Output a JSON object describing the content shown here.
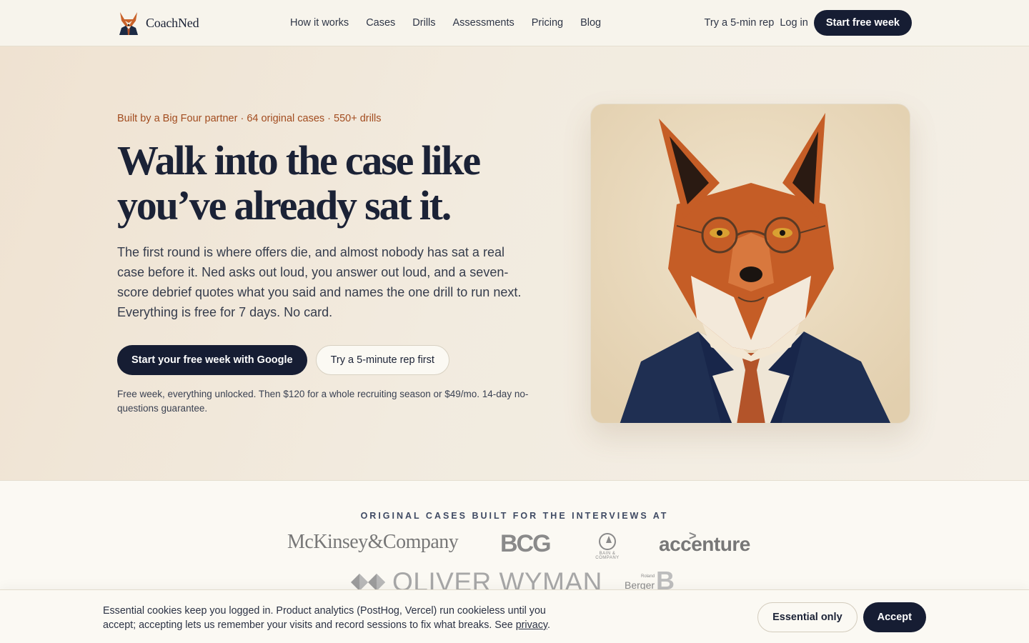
{
  "nav": {
    "brand": "CoachNed",
    "links": [
      "How it works",
      "Cases",
      "Drills",
      "Assessments",
      "Pricing",
      "Blog"
    ],
    "try_rep": "Try a 5-min rep",
    "login": "Log in",
    "cta": "Start free week"
  },
  "hero": {
    "kicker": "Built by a Big Four partner · 64 original cases · 550+ drills",
    "headline": "Walk into the case like you’ve already sat it.",
    "lede": "The first round is where offers die, and almost nobody has sat a real case before it. Ned asks out loud, you answer out loud, and a seven-score debrief quotes what you said and names the one drill to run next. Everything is free for 7 days. No card.",
    "primary_cta": "Start your free week with Google",
    "secondary_cta": "Try a 5-minute rep first",
    "fineprint": "Free week, everything unlocked. Then $120 for a whole recruiting season or $49/mo. 14-day no-questions guarantee.",
    "image_icon": "fox-in-suit-illustration"
  },
  "logos": {
    "title": "ORIGINAL CASES BUILT FOR THE INTERVIEWS AT",
    "items": {
      "mckinsey": "McKinsey&Company",
      "bcg": "BCG",
      "bain": "BAIN & COMPANY",
      "accenture": "accenture",
      "oliver_wyman": "OLIVER WYMAN",
      "roland_small": "Roland",
      "roland_name": "Berger"
    }
  },
  "cookie": {
    "text": "Essential cookies keep you logged in. Product analytics (PostHog, Vercel) run cookieless until you accept; accepting lets us remember your visits and record sessions to fix what breaks. See",
    "link": "privacy",
    "period": ".",
    "essential_only": "Essential only",
    "accept": "Accept"
  },
  "colors": {
    "navy": "#161d33",
    "accent_rust": "#a24c1f",
    "hero_bg": "#f2ebdf",
    "page_bg": "#fbf9f3"
  }
}
